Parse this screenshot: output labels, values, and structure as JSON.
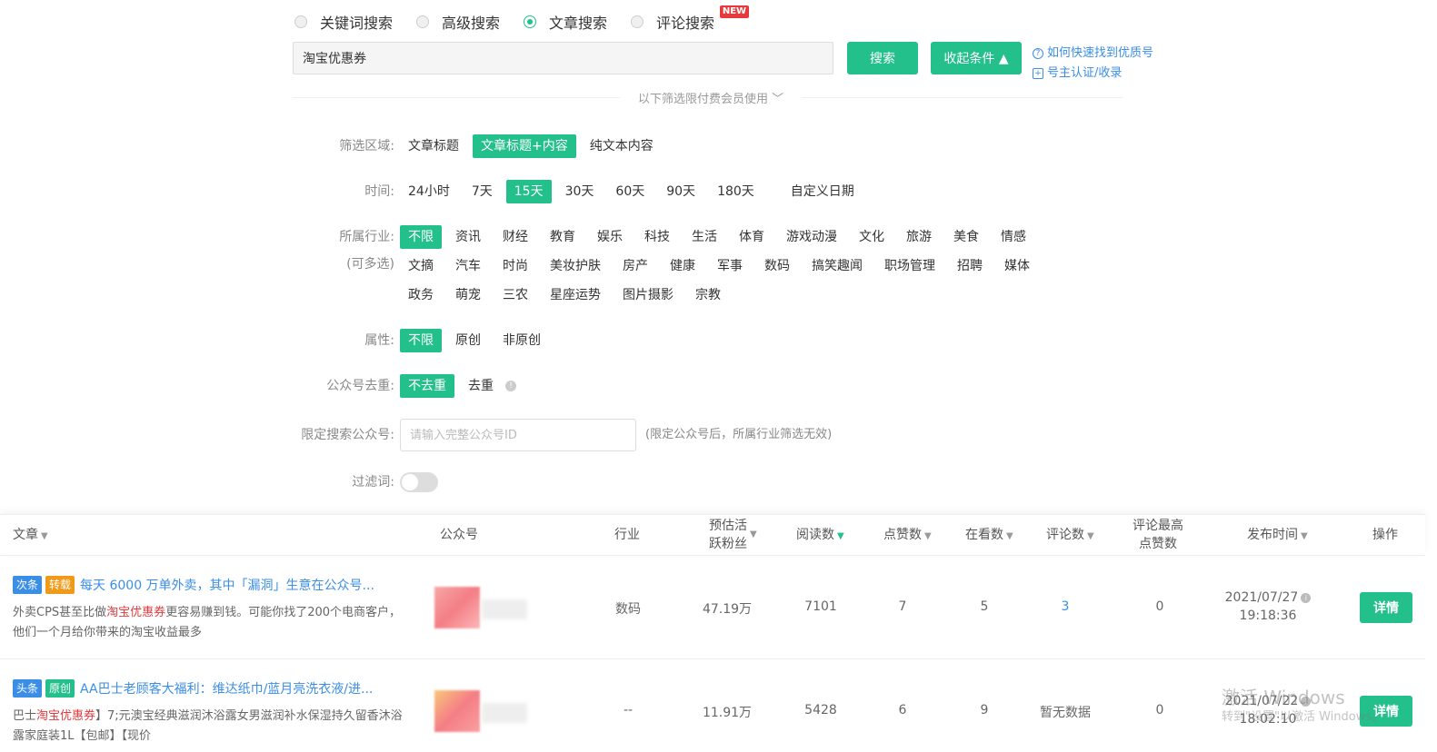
{
  "search_types": [
    {
      "label": "关键词搜索",
      "selected": false
    },
    {
      "label": "高级搜索",
      "selected": false
    },
    {
      "label": "文章搜索",
      "selected": true
    },
    {
      "label": "评论搜索",
      "selected": false,
      "badge": "NEW"
    }
  ],
  "search": {
    "value": "淘宝优惠券",
    "search_label": "搜索",
    "collapse_label": "收起条件 ▲"
  },
  "help": {
    "find_quality": "如何快速找到优质号",
    "owner_cert": "号主认证/收录"
  },
  "divider_text": "以下筛选限付费会员使用 ﹀",
  "filters": {
    "area": {
      "label": "筛选区域:",
      "options": [
        "文章标题",
        "文章标题+内容",
        "纯文本内容"
      ],
      "active": 1
    },
    "time": {
      "label": "时间:",
      "options": [
        "24小时",
        "7天",
        "15天",
        "30天",
        "60天",
        "90天",
        "180天",
        "自定义日期"
      ],
      "active": 2
    },
    "industry": {
      "label": "所属行业:",
      "sublabel": "(可多选)",
      "options": [
        "不限",
        "资讯",
        "财经",
        "教育",
        "娱乐",
        "科技",
        "生活",
        "体育",
        "游戏动漫",
        "文化",
        "旅游",
        "美食",
        "情感",
        "文摘",
        "汽车",
        "时尚",
        "美妆护肤",
        "房产",
        "健康",
        "军事",
        "数码",
        "搞笑趣闻",
        "职场管理",
        "招聘",
        "媒体",
        "政务",
        "萌宠",
        "三农",
        "星座运势",
        "图片摄影",
        "宗教"
      ],
      "active": 0
    },
    "attribute": {
      "label": "属性:",
      "options": [
        "不限",
        "原创",
        "非原创"
      ],
      "active": 0
    },
    "dedupe": {
      "label": "公众号去重:",
      "options": [
        "不去重",
        "去重"
      ],
      "active": 0
    },
    "limit_gzh": {
      "label": "限定搜索公众号:",
      "placeholder": "请输入完整公众号ID",
      "note": "(限定公众号后，所属行业筛选无效)"
    },
    "filter_word": {
      "label": "过滤词:"
    }
  },
  "table": {
    "headers": {
      "article": "文章",
      "gzh": "公众号",
      "industry": "行业",
      "active_fans_1": "预估活",
      "active_fans_2": "跃粉丝",
      "reads": "阅读数",
      "likes": "点赞数",
      "watching": "在看数",
      "comments": "评论数",
      "top_comment_1": "评论最高",
      "top_comment_2": "点赞数",
      "publish_time": "发布时间",
      "action": "操作"
    },
    "rows": [
      {
        "tags": [
          {
            "text": "次条",
            "color": "blue"
          },
          {
            "text": "转载",
            "color": "orange"
          }
        ],
        "title": "每天 6000 万单外卖，其中「漏洞」生意在公众号...",
        "desc_pre": "外卖CPS甚至比做",
        "desc_hl": "淘宝优惠券",
        "desc_post": "更容易赚到钱。可能你找了200个电商客户，他们一个月给你带来的淘宝收益最多",
        "industry": "数码",
        "active_fans": "47.19万",
        "reads": "7101",
        "likes": "7",
        "watching": "5",
        "comments": "3",
        "top_comment_likes": "0",
        "date": "2021/07/27",
        "time": "19:18:36",
        "action": "详情"
      },
      {
        "tags": [
          {
            "text": "头条",
            "color": "blue"
          },
          {
            "text": "原创",
            "color": "green"
          }
        ],
        "title": "AA巴士老顾客大福利：维达纸巾/蓝月亮洗衣液/进...",
        "desc_pre": "巴士",
        "desc_hl": "淘宝优惠券",
        "desc_post": "】7;元澳宝经典滋润沐浴露女男滋润补水保湿持久留香沐浴露家庭装1L【包邮】【现价",
        "industry": "--",
        "active_fans": "11.91万",
        "reads": "5428",
        "likes": "6",
        "watching": "9",
        "comments": "暂无数据",
        "top_comment_likes": "0",
        "date": "2021/07/22",
        "time": "18:02:10",
        "action": "详情"
      }
    ]
  },
  "watermark": {
    "line1": "激活 Windows",
    "line2": "转到\"设置\"以激活 Windows。"
  },
  "colors": {
    "accent": "#23c08b",
    "link": "#3a8ee6",
    "highlight": "#e6393c"
  }
}
